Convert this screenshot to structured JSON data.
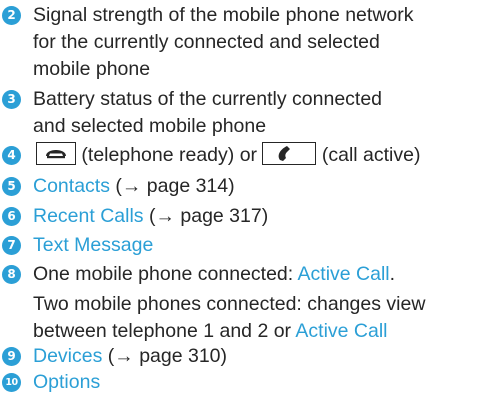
{
  "items": [
    {
      "number": "2",
      "lines": [
        "Signal strength of the mobile phone network",
        "for the currently connected and selected",
        "mobile phone"
      ]
    },
    {
      "number": "3",
      "lines": [
        "Battery status of the currently connected",
        "and selected mobile phone"
      ]
    },
    {
      "number": "4",
      "text_ready": "(telephone ready) or",
      "text_active": "(call active)",
      "icons": [
        "telephone-ready-icon",
        "call-active-icon"
      ]
    },
    {
      "number": "5",
      "link": "Contacts",
      "ref": "(→ page 314)"
    },
    {
      "number": "6",
      "link": "Recent Calls",
      "ref": "(→ page 317)"
    },
    {
      "number": "7",
      "link": "Text Message"
    },
    {
      "number": "8",
      "line1_prefix": "One mobile phone connected:",
      "line1_link": "Active Call",
      "line1_suffix": ".",
      "line2": "Two mobile phones connected: changes view",
      "line3_prefix": "between telephone 1 and 2 or",
      "line3_link": "Active Call"
    },
    {
      "number": "9",
      "link": "Devices",
      "ref": "(→ page 310)"
    },
    {
      "number": "10",
      "link": "Options"
    }
  ],
  "colors": {
    "accent": "#2b9fd6",
    "text": "#262626"
  }
}
